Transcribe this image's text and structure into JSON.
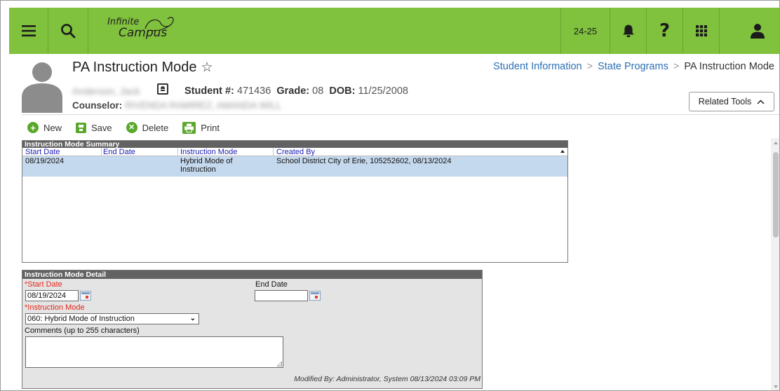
{
  "nav": {
    "logo_line1": "Infinite",
    "logo_line2": "Campus",
    "school_year": "24-25"
  },
  "header": {
    "page_title": "PA Instruction Mode",
    "breadcrumb": [
      "Student Information",
      "State Programs",
      "PA Instruction Mode"
    ],
    "student_name": "Anderson, Jack",
    "student_number_label": "Student #:",
    "student_number": "471436",
    "grade_label": "Grade:",
    "grade": "08",
    "dob_label": "DOB:",
    "dob": "11/25/2008",
    "counselor_label": "Counselor:",
    "counselor_name": "RIVENDA RAMIREZ, AMANDA WILL",
    "related_tools_label": "Related Tools"
  },
  "toolbar": {
    "new_label": "New",
    "save_label": "Save",
    "delete_label": "Delete",
    "print_label": "Print"
  },
  "summary": {
    "title": "Instruction Mode Summary",
    "columns": [
      "Start Date",
      "End Date",
      "Instruction Mode",
      "Created By"
    ],
    "rows": [
      {
        "start_date": "08/19/2024",
        "end_date": "",
        "instruction_mode_l1": "Hybrid Mode of",
        "instruction_mode_l2": "Instruction",
        "created_by": "School District City of Erie, 105252602, 08/13/2024"
      }
    ]
  },
  "detail": {
    "title": "Instruction Mode Detail",
    "start_date_label": "*Start Date",
    "start_date_value": "08/19/2024",
    "end_date_label": "End Date",
    "end_date_value": "",
    "instruction_mode_label": "*Instruction Mode",
    "instruction_mode_value": "060: Hybrid Mode of Instruction",
    "comments_label": "Comments (up to 255 characters)",
    "comments_value": "",
    "modified_by": "Modified By: Administrator, System 08/13/2024 03:09 PM"
  },
  "colors": {
    "nav_green": "#80c13e",
    "link_blue": "#2d6fb6",
    "header_blue": "#1e1eb4",
    "required_red": "#e5261a",
    "row_selected": "#c5d9ee"
  }
}
